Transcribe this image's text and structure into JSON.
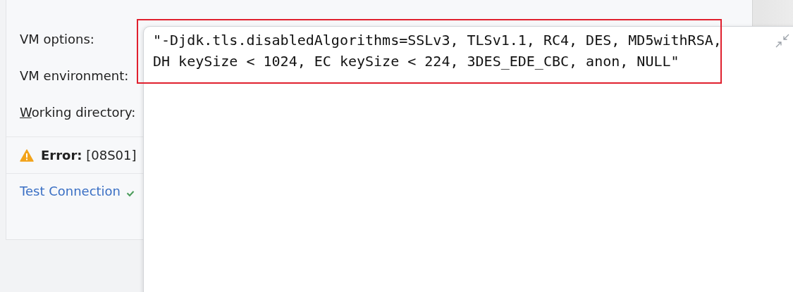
{
  "form": {
    "fields": [
      {
        "label": "VM options:",
        "mnemonic": false
      },
      {
        "label": "VM environment:",
        "mnemonic": false
      },
      {
        "label": "Working directory:",
        "mnemonic": true
      }
    ]
  },
  "error": {
    "text": "**Error:** [08S01]"
  },
  "test_connection": {
    "label": "Test Connection",
    "passed": true
  },
  "editor_popup": {
    "value": "\"-Djdk.tls.disabledAlgorithms=SSLv3, TLSv1.1, RC4, DES, MD5withRSA, DH keySize < 1024, EC keySize < 224, 3DES_EDE_CBC, anon, NULL\"",
    "highlighted": true
  }
}
